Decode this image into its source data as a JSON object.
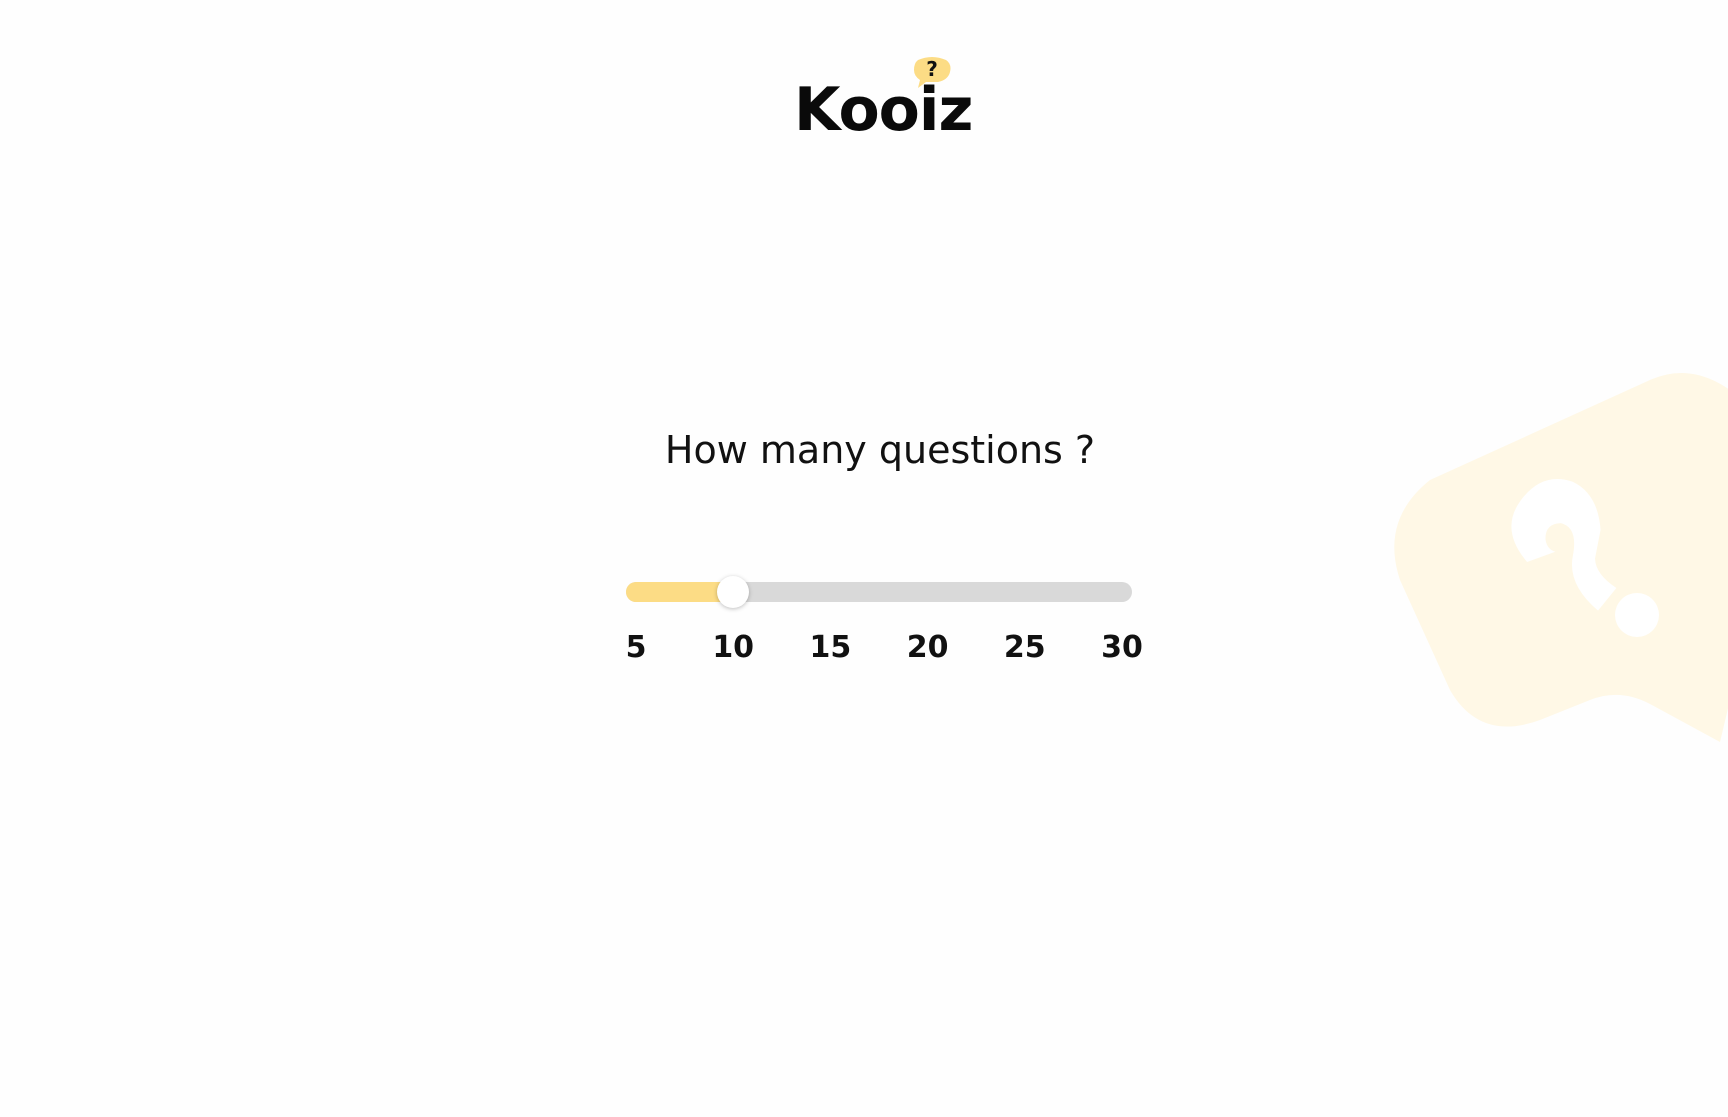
{
  "brand": {
    "name": "Kooiz",
    "bubble_glyph": "?",
    "accent_color": "#fcdc85",
    "accent_light_color": "#fff8e6"
  },
  "question": {
    "text": "How many questions ?"
  },
  "slider": {
    "min": 5,
    "max": 30,
    "step": 5,
    "value": 10,
    "track_color": "#d9d9d9",
    "fill_color": "#fcdc85",
    "ticks": [
      "5",
      "10",
      "15",
      "20",
      "25",
      "30"
    ]
  },
  "decoration": {
    "icon": "question-bubble-icon",
    "glyph": "?"
  }
}
